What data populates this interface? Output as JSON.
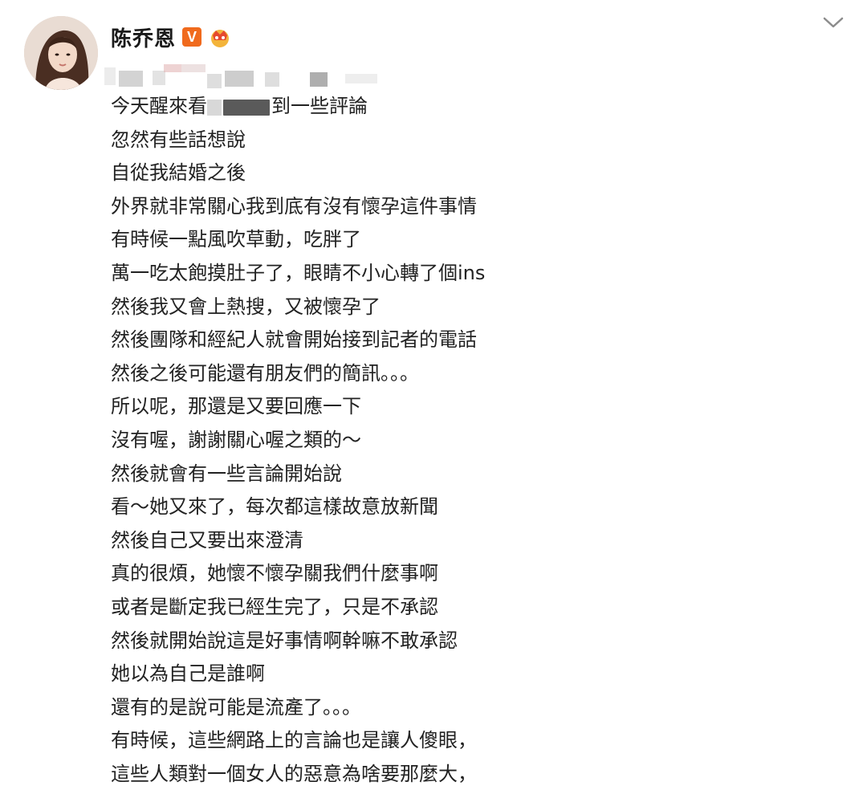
{
  "post": {
    "author": {
      "name": "陈乔恩",
      "verified_badge": "V",
      "avatar_icon": "avatar-photo",
      "vip_icon": "crown-vip-icon"
    },
    "menu_icon": "chevron-down-icon",
    "lines": [
      "今天醒來看",
      "到一些評論",
      "忽然有些話想說",
      "自從我結婚之後",
      "外界就非常關心我到底有沒有懷孕這件事情",
      "有時候一點風吹草動，吃胖了",
      "萬一吃太飽摸肚子了，眼睛不小心轉了個ins",
      "然後我又會上熱搜，又被懷孕了",
      "然後團隊和經紀人就會開始接到記者的電話",
      "然後之後可能還有朋友們的簡訊。。。",
      "所以呢，那還是又要回應一下",
      "沒有喔，謝謝關心喔之類的～",
      "然後就會有一些言論開始說",
      "看～她又來了，每次都這樣故意放新聞",
      "然後自己又要出來澄清",
      "真的很煩，她懷不懷孕關我們什麼事啊",
      "或者是斷定我已經生完了，只是不承認",
      "然後就開始說這是好事情啊幹嘛不敢承認",
      "她以為自己是誰啊",
      "還有的是說可能是流產了。。。",
      "有時候，這些網路上的言論也是讓人傻眼，",
      "這些人類對一個女人的惡意為啥要那麼大，"
    ]
  },
  "colors": {
    "badge": "#f06a1d",
    "text": "#222222",
    "background": "#ffffff"
  }
}
